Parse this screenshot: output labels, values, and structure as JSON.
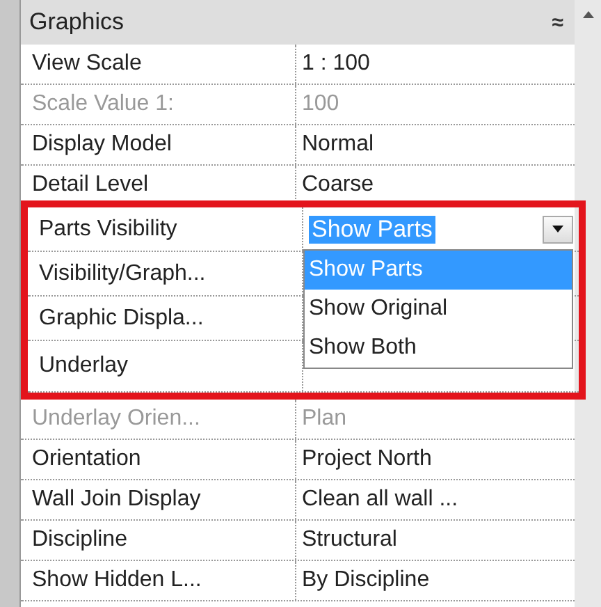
{
  "panel": {
    "title": "Graphics",
    "collapse_icon": "≈"
  },
  "rows_before": [
    {
      "name": "View Scale",
      "value": "1 : 100",
      "disabled": false
    },
    {
      "name": "Scale Value    1:",
      "value": "100",
      "disabled": true
    },
    {
      "name": "Display Model",
      "value": "Normal",
      "disabled": false
    },
    {
      "name": "Detail Level",
      "value": "Coarse",
      "disabled": false
    }
  ],
  "highlighted": {
    "rows": [
      {
        "name": "Parts Visibility",
        "kind": "dropdown",
        "value": "Show Parts",
        "options": [
          {
            "label": "Show Parts",
            "selected": true
          },
          {
            "label": "Show Original",
            "selected": false
          },
          {
            "label": "Show Both",
            "selected": false
          }
        ]
      },
      {
        "name": "Visibility/Graph...",
        "kind": "plain"
      },
      {
        "name": "Graphic Displa...",
        "kind": "plain"
      },
      {
        "name": "Underlay",
        "kind": "plain"
      }
    ]
  },
  "rows_after": [
    {
      "name": "Underlay Orien...",
      "value": "Plan",
      "disabled": true
    },
    {
      "name": "Orientation",
      "value": "Project North",
      "disabled": false
    },
    {
      "name": "Wall Join Display",
      "value": "Clean all wall ...",
      "disabled": false
    },
    {
      "name": "Discipline",
      "value": "Structural",
      "disabled": false
    },
    {
      "name": "Show Hidden L...",
      "value": "By Discipline",
      "disabled": false
    }
  ]
}
